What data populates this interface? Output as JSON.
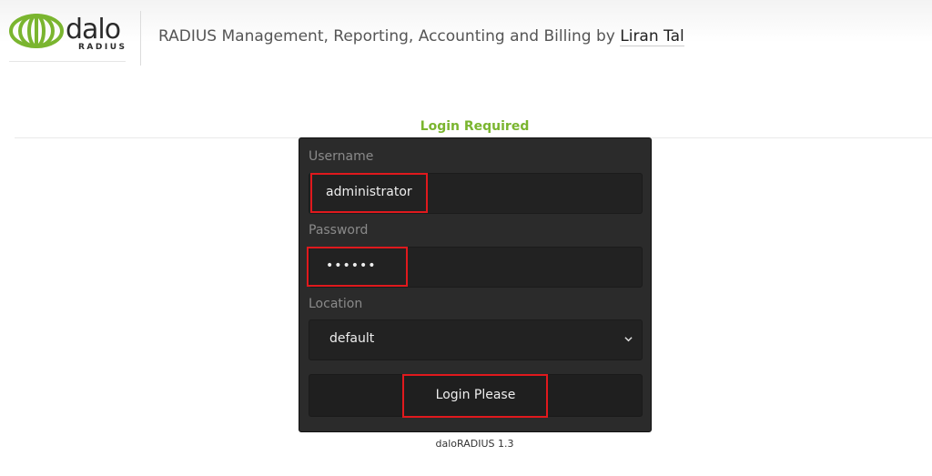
{
  "header": {
    "logo_text": "dalo",
    "logo_sub": "RADIUS",
    "tagline": "RADIUS Management, Reporting, Accounting and Billing by",
    "author": "Liran Tal"
  },
  "login": {
    "title": "Login Required",
    "username_label": "Username",
    "username_value": "administrator",
    "password_label": "Password",
    "password_value": "••••••",
    "location_label": "Location",
    "location_value": "default",
    "submit_label": "Login Please"
  },
  "footer": {
    "version": "daloRADIUS 1.3"
  },
  "colors": {
    "accent": "#7ab52f",
    "panel_bg": "#2b2b2b",
    "highlight": "#e0191d"
  },
  "icons": {
    "logo": "globe-logo-icon",
    "select": "chevron-down-icon"
  }
}
